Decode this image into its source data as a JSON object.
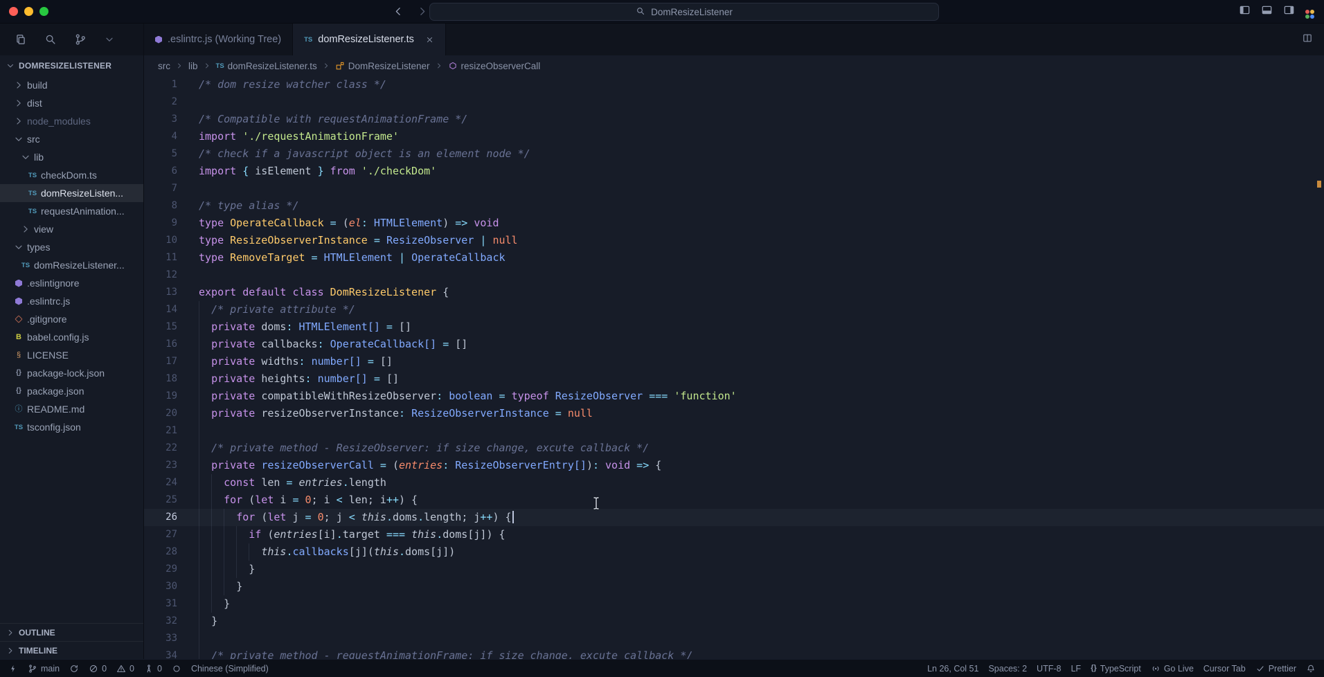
{
  "titlebar": {
    "search_text": "DomResizeListener"
  },
  "tabs": [
    {
      "icon": "eslint",
      "label": ".eslintrc.js (Working Tree)",
      "active": false,
      "closable": false
    },
    {
      "icon": "ts",
      "label": "domResizeListener.ts",
      "active": true,
      "closable": true
    }
  ],
  "breadcrumbs": {
    "items": [
      {
        "icon": "",
        "label": "src"
      },
      {
        "icon": "",
        "label": "lib"
      },
      {
        "icon": "ts",
        "label": "domResizeListener.ts"
      },
      {
        "icon": "class",
        "label": "DomResizeListener"
      },
      {
        "icon": "method",
        "label": "resizeObserverCall"
      }
    ]
  },
  "sidebar": {
    "header": "DOMRESIZELISTENER",
    "outline_label": "OUTLINE",
    "timeline_label": "TIMELINE",
    "tree": [
      {
        "l": "build",
        "d": 0,
        "ch": "right"
      },
      {
        "l": "dist",
        "d": 0,
        "ch": "right"
      },
      {
        "l": "node_modules",
        "d": 0,
        "ch": "right",
        "dim": true
      },
      {
        "l": "src",
        "d": 0,
        "ch": "down"
      },
      {
        "l": "lib",
        "d": 1,
        "ch": "down"
      },
      {
        "l": "checkDom.ts",
        "d": 2,
        "ic": "ts"
      },
      {
        "l": "domResizeListen...",
        "d": 2,
        "ic": "ts",
        "sel": true
      },
      {
        "l": "requestAnimation...",
        "d": 2,
        "ic": "ts"
      },
      {
        "l": "view",
        "d": 1,
        "ch": "right"
      },
      {
        "l": "types",
        "d": 0,
        "ch": "down"
      },
      {
        "l": "domResizeListener...",
        "d": 1,
        "ic": "ts"
      },
      {
        "l": ".eslintignore",
        "d": 0,
        "ic": "eslint"
      },
      {
        "l": ".eslintrc.js",
        "d": 0,
        "ic": "eslint"
      },
      {
        "l": ".gitignore",
        "d": 0,
        "ic": "git"
      },
      {
        "l": "babel.config.js",
        "d": 0,
        "ic": "babel"
      },
      {
        "l": "LICENSE",
        "d": 0,
        "ic": "license"
      },
      {
        "l": "package-lock.json",
        "d": 0,
        "ic": "json"
      },
      {
        "l": "package.json",
        "d": 0,
        "ic": "json"
      },
      {
        "l": "README.md",
        "d": 0,
        "ic": "readme"
      },
      {
        "l": "tsconfig.json",
        "d": 0,
        "ic": "tsconfig"
      }
    ]
  },
  "code": {
    "lines": [
      {
        "n": 1,
        "i": 0,
        "t": [
          [
            "c",
            "/* dom resize watcher class */"
          ]
        ]
      },
      {
        "n": 2,
        "i": 0,
        "t": []
      },
      {
        "n": 3,
        "i": 0,
        "t": [
          [
            "c",
            "/* Compatible with requestAnimationFrame */"
          ]
        ]
      },
      {
        "n": 4,
        "i": 0,
        "t": [
          [
            "k",
            "import "
          ],
          [
            "s",
            "'./requestAnimationFrame'"
          ]
        ]
      },
      {
        "n": 5,
        "i": 0,
        "t": [
          [
            "c",
            "/* check if a javascript object is an element node */"
          ]
        ]
      },
      {
        "n": 6,
        "i": 0,
        "t": [
          [
            "k",
            "import "
          ],
          [
            "op",
            "{ "
          ],
          [
            "w",
            "isElement"
          ],
          [
            "op",
            " } "
          ],
          [
            "k",
            "from "
          ],
          [
            "s",
            "'./checkDom'"
          ]
        ]
      },
      {
        "n": 7,
        "i": 0,
        "t": []
      },
      {
        "n": 8,
        "i": 0,
        "t": [
          [
            "c",
            "/* type alias */"
          ]
        ]
      },
      {
        "n": 9,
        "i": 0,
        "t": [
          [
            "k",
            "type "
          ],
          [
            "y",
            "OperateCallback"
          ],
          [
            "op",
            " = "
          ],
          [
            "w",
            "("
          ],
          [
            "pi",
            "el"
          ],
          [
            "op",
            ": "
          ],
          [
            "t",
            "HTMLElement"
          ],
          [
            "w",
            ")"
          ],
          [
            "op",
            " => "
          ],
          [
            "k",
            "void"
          ]
        ]
      },
      {
        "n": 10,
        "i": 0,
        "t": [
          [
            "k",
            "type "
          ],
          [
            "y",
            "ResizeObserverInstance"
          ],
          [
            "op",
            " = "
          ],
          [
            "t",
            "ResizeObserver"
          ],
          [
            "op",
            " | "
          ],
          [
            "o",
            "null"
          ]
        ]
      },
      {
        "n": 11,
        "i": 0,
        "t": [
          [
            "k",
            "type "
          ],
          [
            "y",
            "RemoveTarget"
          ],
          [
            "op",
            " = "
          ],
          [
            "t",
            "HTMLElement"
          ],
          [
            "op",
            " | "
          ],
          [
            "t",
            "OperateCallback"
          ]
        ]
      },
      {
        "n": 12,
        "i": 0,
        "t": []
      },
      {
        "n": 13,
        "i": 0,
        "t": [
          [
            "k",
            "export default class "
          ],
          [
            "y",
            "DomResizeListener"
          ],
          [
            "w",
            " {"
          ]
        ]
      },
      {
        "n": 14,
        "i": 2,
        "t": [
          [
            "c",
            "/* private attribute */"
          ]
        ]
      },
      {
        "n": 15,
        "i": 2,
        "t": [
          [
            "k",
            "private "
          ],
          [
            "w",
            "doms"
          ],
          [
            "op",
            ": "
          ],
          [
            "t",
            "HTMLElement[]"
          ],
          [
            "op",
            " = "
          ],
          [
            "w",
            "[]"
          ]
        ]
      },
      {
        "n": 16,
        "i": 2,
        "t": [
          [
            "k",
            "private "
          ],
          [
            "w",
            "callbacks"
          ],
          [
            "op",
            ": "
          ],
          [
            "t",
            "OperateCallback[]"
          ],
          [
            "op",
            " = "
          ],
          [
            "w",
            "[]"
          ]
        ]
      },
      {
        "n": 17,
        "i": 2,
        "t": [
          [
            "k",
            "private "
          ],
          [
            "w",
            "widths"
          ],
          [
            "op",
            ": "
          ],
          [
            "t",
            "number[]"
          ],
          [
            "op",
            " = "
          ],
          [
            "w",
            "[]"
          ]
        ]
      },
      {
        "n": 18,
        "i": 2,
        "t": [
          [
            "k",
            "private "
          ],
          [
            "w",
            "heights"
          ],
          [
            "op",
            ": "
          ],
          [
            "t",
            "number[]"
          ],
          [
            "op",
            " = "
          ],
          [
            "w",
            "[]"
          ]
        ]
      },
      {
        "n": 19,
        "i": 2,
        "t": [
          [
            "k",
            "private "
          ],
          [
            "w",
            "compatibleWithResizeObserver"
          ],
          [
            "op",
            ": "
          ],
          [
            "t",
            "boolean"
          ],
          [
            "op",
            " = "
          ],
          [
            "k",
            "typeof "
          ],
          [
            "t",
            "ResizeObserver"
          ],
          [
            "op",
            " === "
          ],
          [
            "s",
            "'function'"
          ]
        ]
      },
      {
        "n": 20,
        "i": 2,
        "t": [
          [
            "k",
            "private "
          ],
          [
            "w",
            "resizeObserverInstance"
          ],
          [
            "op",
            ": "
          ],
          [
            "t",
            "ResizeObserverInstance"
          ],
          [
            "op",
            " = "
          ],
          [
            "o",
            "null"
          ]
        ]
      },
      {
        "n": 21,
        "i": 2,
        "t": []
      },
      {
        "n": 22,
        "i": 2,
        "t": [
          [
            "c",
            "/* private method - ResizeObserver: if size change, excute callback */"
          ]
        ]
      },
      {
        "n": 23,
        "i": 2,
        "t": [
          [
            "k",
            "private "
          ],
          [
            "f",
            "resizeObserverCall"
          ],
          [
            "op",
            " = "
          ],
          [
            "w",
            "("
          ],
          [
            "pi",
            "entries"
          ],
          [
            "op",
            ": "
          ],
          [
            "t",
            "ResizeObserverEntry[]"
          ],
          [
            "w",
            ")"
          ],
          [
            "op",
            ": "
          ],
          [
            "k",
            "void"
          ],
          [
            "op",
            " => "
          ],
          [
            "w",
            "{"
          ]
        ]
      },
      {
        "n": 24,
        "i": 4,
        "t": [
          [
            "k",
            "const "
          ],
          [
            "w",
            "len"
          ],
          [
            "op",
            " = "
          ],
          [
            "wi",
            "entries"
          ],
          [
            "op",
            "."
          ],
          [
            "w",
            "length"
          ]
        ]
      },
      {
        "n": 25,
        "i": 4,
        "t": [
          [
            "k",
            "for "
          ],
          [
            "w",
            "("
          ],
          [
            "k",
            "let "
          ],
          [
            "w",
            "i"
          ],
          [
            "op",
            " = "
          ],
          [
            "o",
            "0"
          ],
          [
            "w",
            "; "
          ],
          [
            "w",
            "i"
          ],
          [
            "op",
            " < "
          ],
          [
            "w",
            "len"
          ],
          [
            "w",
            "; "
          ],
          [
            "w",
            "i"
          ],
          [
            "op",
            "++"
          ],
          [
            "w",
            ") {"
          ]
        ]
      },
      {
        "n": 26,
        "i": 6,
        "current": true,
        "caret": true,
        "t": [
          [
            "k",
            "for "
          ],
          [
            "w",
            "("
          ],
          [
            "k",
            "let "
          ],
          [
            "w",
            "j"
          ],
          [
            "op",
            " = "
          ],
          [
            "o",
            "0"
          ],
          [
            "w",
            "; "
          ],
          [
            "w",
            "j"
          ],
          [
            "op",
            " < "
          ],
          [
            "wi",
            "this"
          ],
          [
            "op",
            "."
          ],
          [
            "w",
            "doms"
          ],
          [
            "op",
            "."
          ],
          [
            "w",
            "length"
          ],
          [
            "w",
            "; "
          ],
          [
            "w",
            "j"
          ],
          [
            "op",
            "++"
          ],
          [
            "w",
            ") {"
          ]
        ]
      },
      {
        "n": 27,
        "i": 8,
        "t": [
          [
            "k",
            "if "
          ],
          [
            "w",
            "("
          ],
          [
            "wi",
            "entries"
          ],
          [
            "w",
            "["
          ],
          [
            "w",
            "i"
          ],
          [
            "w",
            "]"
          ],
          [
            "op",
            "."
          ],
          [
            "w",
            "target"
          ],
          [
            "op",
            " === "
          ],
          [
            "wi",
            "this"
          ],
          [
            "op",
            "."
          ],
          [
            "w",
            "doms"
          ],
          [
            "w",
            "["
          ],
          [
            "w",
            "j"
          ],
          [
            "w",
            "]"
          ],
          [
            "w",
            ") {"
          ]
        ]
      },
      {
        "n": 28,
        "i": 10,
        "t": [
          [
            "wi",
            "this"
          ],
          [
            "op",
            "."
          ],
          [
            "f",
            "callbacks"
          ],
          [
            "w",
            "["
          ],
          [
            "w",
            "j"
          ],
          [
            "w",
            "]("
          ],
          [
            "wi",
            "this"
          ],
          [
            "op",
            "."
          ],
          [
            "w",
            "doms"
          ],
          [
            "w",
            "["
          ],
          [
            "w",
            "j"
          ],
          [
            "w",
            "])"
          ]
        ]
      },
      {
        "n": 29,
        "i": 8,
        "t": [
          [
            "w",
            "}"
          ]
        ]
      },
      {
        "n": 30,
        "i": 6,
        "t": [
          [
            "w",
            "}"
          ]
        ]
      },
      {
        "n": 31,
        "i": 4,
        "t": [
          [
            "w",
            "}"
          ]
        ]
      },
      {
        "n": 32,
        "i": 2,
        "t": [
          [
            "w",
            "}"
          ]
        ]
      },
      {
        "n": 33,
        "i": 2,
        "t": []
      },
      {
        "n": 34,
        "i": 2,
        "t": [
          [
            "c",
            "/* private method - requestAnimationFrame: if size change, excute callback */"
          ]
        ]
      }
    ]
  },
  "status": {
    "left": [
      {
        "icon": "bolt",
        "label": ""
      },
      {
        "icon": "branch",
        "label": "main"
      },
      {
        "icon": "sync",
        "label": ""
      },
      {
        "icon": "error",
        "label": "0"
      },
      {
        "icon": "warning",
        "label": "0"
      },
      {
        "icon": "tower",
        "label": "0"
      },
      {
        "icon": "circle",
        "label": ""
      },
      {
        "icon": "",
        "label": "Chinese (Simplified)"
      }
    ],
    "right": [
      {
        "icon": "",
        "label": "Ln 26, Col 51"
      },
      {
        "icon": "",
        "label": "Spaces: 2"
      },
      {
        "icon": "",
        "label": "UTF-8"
      },
      {
        "icon": "",
        "label": "LF"
      },
      {
        "icon": "braces",
        "label": "TypeScript"
      },
      {
        "icon": "broadcast",
        "label": "Go Live"
      },
      {
        "icon": "",
        "label": "Cursor Tab"
      },
      {
        "icon": "check",
        "label": "Prettier"
      },
      {
        "icon": "bell",
        "label": ""
      }
    ]
  },
  "theme": {
    "editor_bg": "#171c28",
    "sidebar_bg": "#151a25",
    "topbar_bg": "#10141d",
    "titlebar_bg": "#0c101a",
    "statusbar_bg": "#0c1018",
    "accent": "#82aaff",
    "ts_icon_color": "#519aba",
    "eslint_icon_color": "#8f7ad6",
    "overview_mark_color": "#c98a3d",
    "traffic_lights": [
      "#ff5f57",
      "#febc2e",
      "#28c840"
    ],
    "syntax": {
      "keyword": "#c792ea",
      "string": "#c3e88d",
      "type": "#82aaff",
      "typedecl": "#ffcb6b",
      "number": "#f78c6c",
      "operator": "#89ddff",
      "comment": "#697294",
      "text": "#bfc7d5",
      "function": "#82aaff"
    }
  }
}
